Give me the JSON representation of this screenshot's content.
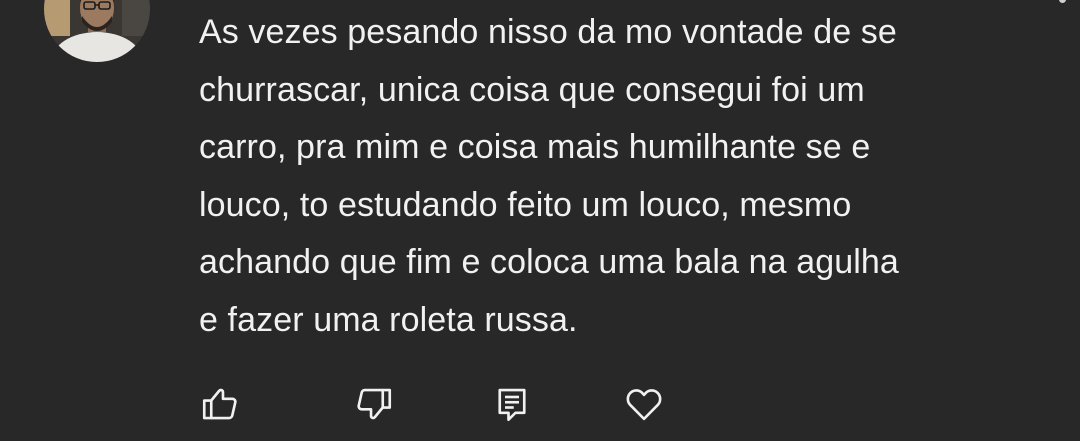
{
  "comment": {
    "text": "As vezes pesando nisso da mo vontade de se\nchurrascar, unica coisa que consegui foi um\ncarro, pra mim e coisa mais humilhante se e\nlouco, to estudando feito um louco, mesmo\nachando que fim e coloca uma bala na agulha\ne fazer uma roleta russa."
  },
  "actions": [
    {
      "icon": "thumbs-up-icon"
    },
    {
      "icon": "thumbs-down-icon"
    },
    {
      "icon": "reply-icon"
    },
    {
      "icon": "heart-icon"
    }
  ],
  "colors": {
    "background": "#282828",
    "text": "#f1f1f1",
    "icon": "#f1f1f1"
  }
}
